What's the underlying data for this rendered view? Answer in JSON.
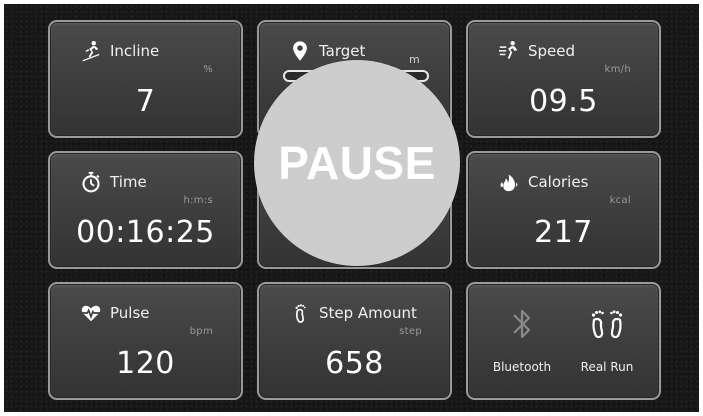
{
  "tiles": {
    "incline": {
      "label": "Incline",
      "unit": "%",
      "value": "7",
      "icon": "incline-runner-icon"
    },
    "target": {
      "label": "Target",
      "unit": "m",
      "icon": "location-pin-icon"
    },
    "speed": {
      "label": "Speed",
      "unit": "km/h",
      "value": "09.5",
      "icon": "speed-runner-icon"
    },
    "time": {
      "label": "Time",
      "unit": "h:m:s",
      "value": "00:16:25",
      "icon": "stopwatch-icon"
    },
    "calories": {
      "label": "Calories",
      "unit": "kcal",
      "value": "217",
      "icon": "flame-icon"
    },
    "pulse": {
      "label": "Pulse",
      "unit": "bpm",
      "value": "120",
      "icon": "heartbeat-icon"
    },
    "steps": {
      "label": "Step Amount",
      "unit": "step",
      "value": "658",
      "icon": "footprint-icon"
    }
  },
  "controls": {
    "bluetooth_label": "Bluetooth",
    "realrun_label": "Real Run",
    "bluetooth_icon": "bluetooth-icon",
    "realrun_icon": "footprints-icon"
  },
  "overlay": {
    "pause_label": "PAUSE"
  },
  "colors": {
    "screen_bg": "#171717",
    "tile_bg": "#404040",
    "tile_border": "#9a9a9a",
    "pause_circle": "#cdcdcd",
    "text": "#ffffff",
    "unit_text": "#9a9a9a"
  }
}
